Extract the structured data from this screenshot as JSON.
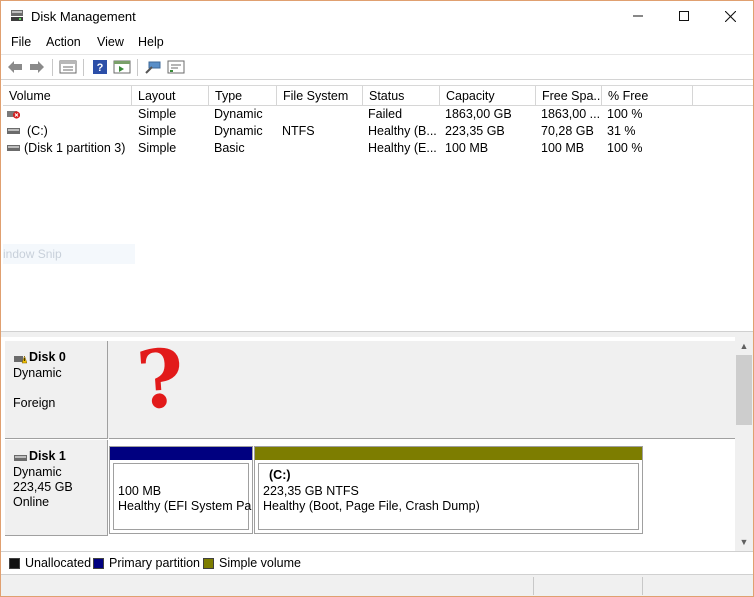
{
  "window": {
    "title": "Disk Management",
    "controls": {
      "minimize": "—",
      "maximize": "☐",
      "close": "✕"
    }
  },
  "menu": [
    "File",
    "Action",
    "View",
    "Help"
  ],
  "toolbar": {
    "icons": [
      "back-arrow-icon",
      "forward-arrow-icon",
      "disk-list-icon",
      "help-icon",
      "properties-icon",
      "connect-icon",
      "settings-icon"
    ]
  },
  "volume_list": {
    "columns": [
      "Volume",
      "Layout",
      "Type",
      "File System",
      "Status",
      "Capacity",
      "Free Spa...",
      "% Free"
    ],
    "rows": [
      {
        "volume": "",
        "layout": "Simple",
        "type": "Dynamic",
        "fs": "",
        "status": "Failed",
        "capacity": "1863,00 GB",
        "free": "1863,00 ...",
        "pct": "100 %",
        "icon": "failed-volume-icon"
      },
      {
        "volume": "(C:)",
        "layout": "Simple",
        "type": "Dynamic",
        "fs": "NTFS",
        "status": "Healthy (B...",
        "capacity": "223,35 GB",
        "free": "70,28 GB",
        "pct": "31 %",
        "icon": "volume-icon"
      },
      {
        "volume": "(Disk 1 partition 3)",
        "layout": "Simple",
        "type": "Basic",
        "fs": "",
        "status": "Healthy (E...",
        "capacity": "100 MB",
        "free": "100 MB",
        "pct": "100 %",
        "icon": "volume-icon"
      }
    ],
    "ghost_text": "indow Snip"
  },
  "disks": [
    {
      "name": "Disk 0",
      "type": "Dynamic",
      "state": "Foreign",
      "annotation": "?"
    },
    {
      "name": "Disk 1",
      "type": "Dynamic",
      "size": "223,45 GB",
      "state": "Online",
      "partitions": [
        {
          "title": "",
          "size": "100 MB",
          "status": "Healthy (EFI System Part",
          "kind": "primary"
        },
        {
          "title": "(C:)",
          "size": "223,35 GB NTFS",
          "status": "Healthy (Boot, Page File, Crash Dump)",
          "kind": "simple"
        }
      ]
    }
  ],
  "legend": [
    {
      "label": "Unallocated",
      "color": "#111111"
    },
    {
      "label": "Primary partition",
      "color": "#000080"
    },
    {
      "label": "Simple volume",
      "color": "#7d7d00"
    }
  ],
  "colors": {
    "primary_bar": "#000080",
    "simple_bar": "#7d7d00",
    "annotation": "#e21a1a"
  }
}
